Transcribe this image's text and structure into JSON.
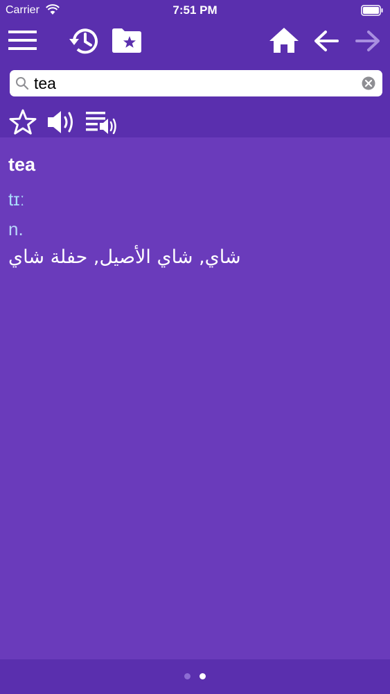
{
  "status_bar": {
    "carrier": "Carrier",
    "time": "7:51 PM"
  },
  "toolbar": {
    "icons": [
      "menu-icon",
      "history-icon",
      "favorites-folder-icon",
      "home-icon",
      "back-arrow-icon",
      "forward-arrow-icon"
    ]
  },
  "search": {
    "value": "tea",
    "placeholder": ""
  },
  "actions": {
    "icons": [
      "star-icon",
      "speaker-icon",
      "play-list-icon"
    ]
  },
  "entry": {
    "word": "tea",
    "pronunciation": "tɪː",
    "part_of_speech": "n.",
    "translation": "شاي, شاي الأصيل, حفلة شاي"
  },
  "pagination": {
    "pages": 2,
    "current": 2
  },
  "colors": {
    "header_background": "#5a2fae",
    "content_background": "#6a3bbb",
    "pronunciation": "#a9dbfb",
    "part_of_speech": "#b8d6fa",
    "forward_disabled": "#a98fe0"
  }
}
